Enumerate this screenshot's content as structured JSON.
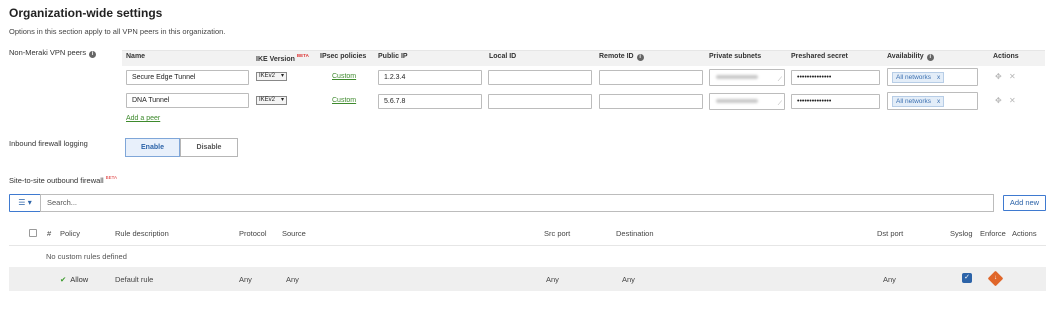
{
  "page": {
    "title": "Organization-wide settings",
    "subtitle": "Options in this section apply to all VPN peers in this organization."
  },
  "peers": {
    "label": "Non-Meraki VPN peers",
    "columns": {
      "name": "Name",
      "ike_version": "IKE Version",
      "ike_beta": "BETA",
      "ipsec_policies": "IPsec policies",
      "public_ip": "Public IP",
      "local_id": "Local ID",
      "remote_id": "Remote ID",
      "private_subnets": "Private subnets",
      "preshared_secret": "Preshared secret",
      "availability": "Availability",
      "actions": "Actions"
    },
    "rows": [
      {
        "name": "Secure Edge Tunnel",
        "ike": "IKEv2",
        "ipsec": "Custom",
        "public_ip": "1.2.3.4",
        "local_id": "",
        "remote_id": "",
        "secret": "••••••••••••••",
        "availability": "All networks"
      },
      {
        "name": "DNA Tunnel",
        "ike": "IKEv2",
        "ipsec": "Custom",
        "public_ip": "5.6.7.8",
        "local_id": "",
        "remote_id": "",
        "secret": "••••••••••••••",
        "availability": "All networks"
      }
    ],
    "add_peer": "Add a peer"
  },
  "logging": {
    "label": "Inbound firewall logging",
    "enable": "Enable",
    "disable": "Disable",
    "selected": "Enable"
  },
  "firewall": {
    "label": "Site-to-site outbound firewall",
    "beta": "BETA",
    "search_placeholder": "Search...",
    "add_new": "Add new",
    "columns": {
      "num": "#",
      "policy": "Policy",
      "rule_description": "Rule description",
      "protocol": "Protocol",
      "source": "Source",
      "src_port": "Src port",
      "destination": "Destination",
      "dst_port": "Dst port",
      "syslog": "Syslog",
      "enforce": "Enforce",
      "actions": "Actions"
    },
    "empty_message": "No custom rules defined",
    "default_rule": {
      "policy": "Allow",
      "description": "Default rule",
      "protocol": "Any",
      "source": "Any",
      "src_port": "Any",
      "destination": "Any",
      "dst_port": "Any",
      "syslog": true
    }
  },
  "colors": {
    "accent": "#2c63a8",
    "link_green": "#3e8a2d",
    "enforce_orange": "#e0662a"
  }
}
